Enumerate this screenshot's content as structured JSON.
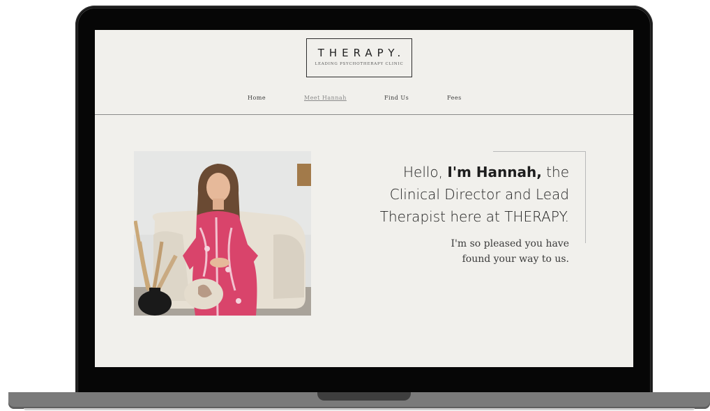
{
  "brand": {
    "title": "THERAPY.",
    "tagline": "LEADING PSYCHOTHERAPY CLINIC"
  },
  "nav": {
    "items": [
      {
        "label": "Home",
        "active": false
      },
      {
        "label": "Meet Hannah",
        "active": true
      },
      {
        "label": "Find Us",
        "active": false
      },
      {
        "label": "Fees",
        "active": false
      }
    ]
  },
  "intro": {
    "greeting": "Hello,",
    "name": "I'm Hannah,",
    "line1_tail": "the",
    "line2": "Clinical Director and Lead",
    "line3": "Therapist here at THERAPY.",
    "sub_line1": "I'm so pleased you have",
    "sub_line2": "found your way to us."
  },
  "colors": {
    "page_bg": "#f1f0ec",
    "text_dark": "#1d1d1d",
    "dress_pink": "#d9446b",
    "laptop_frame": "#060606",
    "laptop_base": "#7a7a7a"
  },
  "icons": {
    "photo": "portrait-photo"
  }
}
